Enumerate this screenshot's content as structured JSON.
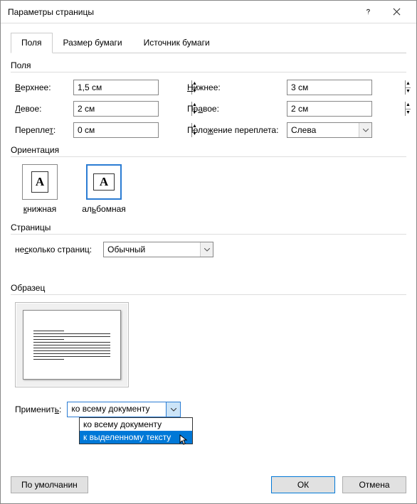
{
  "title": "Параметры страницы",
  "tabs": {
    "t0": "Поля",
    "t1": "Размер бумаги",
    "t2": "Источник бумаги"
  },
  "groups": {
    "margins": "Поля",
    "orientation": "Ориентация",
    "pages": "Страницы",
    "sample": "Образец"
  },
  "margins": {
    "top_label_pre": "",
    "top_label_u": "В",
    "top_label_post": "ерхнее:",
    "top_value": "1,5 см",
    "bottom_label_pre": "",
    "bottom_label_u": "Н",
    "bottom_label_post": "ижнее:",
    "bottom_value": "3 см",
    "left_label_pre": "",
    "left_label_u": "Л",
    "left_label_post": "евое:",
    "left_value": "2 см",
    "right_label_pre": "Пр",
    "right_label_u": "а",
    "right_label_post": "вое:",
    "right_value": "2 см",
    "gutter_label_pre": "Перепле",
    "gutter_label_u": "т",
    "gutter_label_post": ":",
    "gutter_value": "0 см",
    "gutter_pos_label_pre": "Поло",
    "gutter_pos_label_u": "ж",
    "gutter_pos_label_post": "ение переплета:",
    "gutter_pos_value": "Слева"
  },
  "orientation": {
    "portrait_pre": "",
    "portrait_u": "к",
    "portrait_post": "нижная",
    "landscape_pre": "ал",
    "landscape_u": "ь",
    "landscape_post": "бомная",
    "letter": "A"
  },
  "pages": {
    "multi_label_pre": "не",
    "multi_label_u": "с",
    "multi_label_post": "колько страниц:",
    "multi_value": "Обычный"
  },
  "apply": {
    "label_pre": "Применит",
    "label_u": "ь",
    "label_post": ":",
    "value": "ко всему документу",
    "opt0": "ко всему документу",
    "opt1": "к выделенному тексту"
  },
  "footer": {
    "default_btn": "По умолчанин",
    "ok": "ОК",
    "cancel": "Отмена"
  }
}
